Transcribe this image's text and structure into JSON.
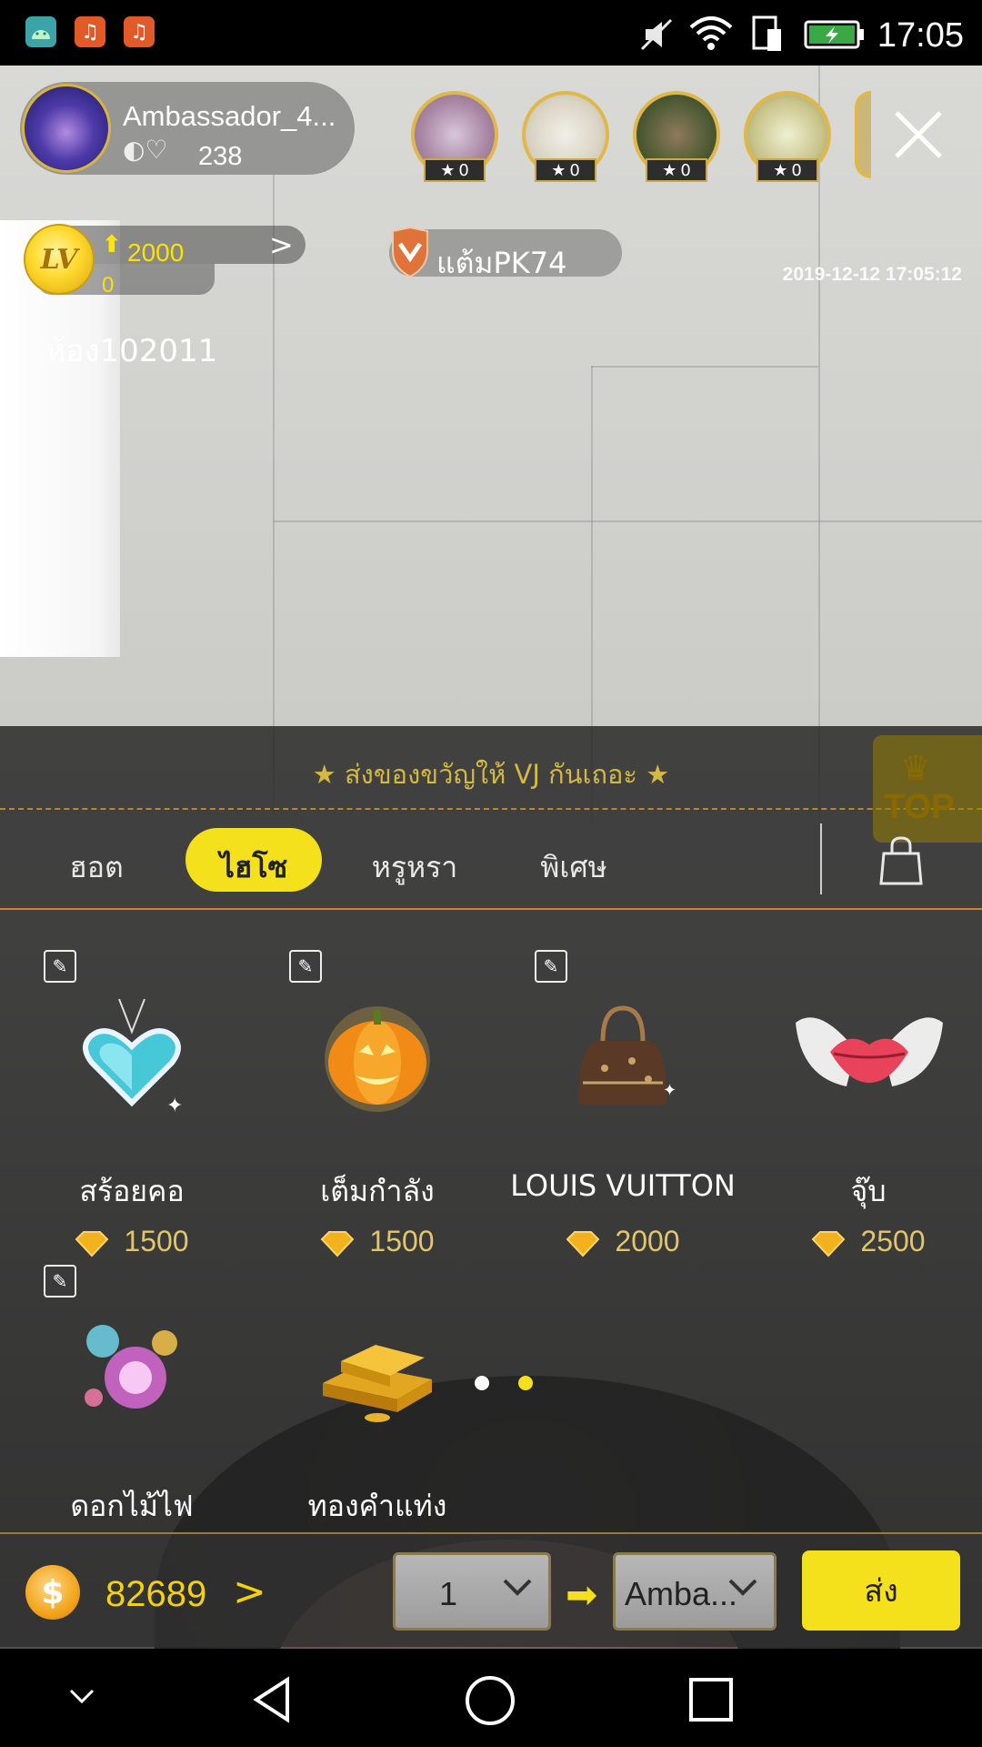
{
  "status_bar": {
    "time": "17:05",
    "app_icons": [
      "android-icon",
      "music-icon",
      "music-icon"
    ],
    "indicators": [
      "mute-icon",
      "wifi-icon",
      "sim-icon",
      "battery-charging-icon"
    ]
  },
  "host": {
    "name": "Ambassador_4...",
    "likes": "238"
  },
  "viewers": [
    {
      "count": "0"
    },
    {
      "count": "0"
    },
    {
      "count": "0"
    },
    {
      "count": "0"
    }
  ],
  "level": {
    "badge": "LV",
    "target": "2000",
    "current": "0"
  },
  "pk": {
    "label": "แต้มPK74"
  },
  "timestamp": "2019-12-12 17:05:12",
  "room": {
    "label": "ห้อง102011"
  },
  "gift_panel": {
    "title": "★  ส่งของขวัญให้ VJ กันเถอะ  ★",
    "top_label": "TOP",
    "tabs": [
      {
        "label": "ฮอต"
      },
      {
        "label": "ไฮโซ"
      },
      {
        "label": "หรูหรา"
      },
      {
        "label": "พิเศษ"
      }
    ],
    "active_tab": "ไฮโซ",
    "gifts": [
      {
        "name": "สร้อยคอ",
        "price": "1500",
        "icon": "heart-necklace-icon",
        "marked": true
      },
      {
        "name": "เต็มกำลัง",
        "price": "1500",
        "icon": "pumpkin-icon",
        "marked": true
      },
      {
        "name": "LOUIS VUITTON",
        "price": "2000",
        "icon": "handbag-icon",
        "marked": true
      },
      {
        "name": "จุ๊บ",
        "price": "2500",
        "icon": "winged-lips-icon",
        "marked": false
      },
      {
        "name": "ดอกไม้ไฟ",
        "price": "",
        "icon": "fireworks-icon",
        "marked": true
      },
      {
        "name": "ทองคำแท่ง",
        "price": "",
        "icon": "gold-bars-icon",
        "marked": false
      }
    ],
    "pages": {
      "total": 2,
      "current": 2
    }
  },
  "send_bar": {
    "balance": "82689",
    "quantity": "1",
    "recipient": "Amba...",
    "send_label": "ส่ง"
  },
  "colors": {
    "accent_yellow": "#f5e01c",
    "gold": "#e2c66b",
    "divider_orange": "#c7833a"
  }
}
